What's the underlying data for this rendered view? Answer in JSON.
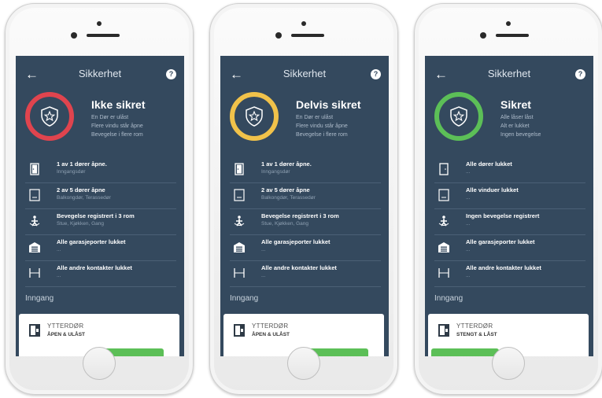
{
  "colors": {
    "red": "#e0444e",
    "yellow": "#f1c24a",
    "green": "#5cbf57",
    "screen_bg": "#34495e"
  },
  "phones": [
    {
      "header": {
        "back": "←",
        "title": "Sikkerhet",
        "help": "?"
      },
      "status": {
        "color": "#e0444e",
        "title": "Ikke sikret",
        "lines": [
          "En Dør er ulåst",
          "Flere vindu står åpne",
          "Bevegelse i flere rom"
        ]
      },
      "rows": [
        {
          "icon": "door-open-icon",
          "title": "1 av 1 dører åpne.",
          "sub": "Inngangsdør"
        },
        {
          "icon": "window-icon",
          "title": "2 av 5 dører åpne",
          "sub": "Balkongdør, Terassedør"
        },
        {
          "icon": "motion-icon",
          "title": "Bevegelse registrert i 3 rom",
          "sub": "Stue, Kjøkken, Gang"
        },
        {
          "icon": "garage-icon",
          "title": "Alle garasjeporter lukket",
          "sub": "..."
        },
        {
          "icon": "contact-icon",
          "title": "Alle andre kontakter lukket",
          "sub": "..."
        }
      ],
      "section": "Inngang",
      "card": {
        "name": "YTTERDØR",
        "state": "ÅPEN & ULÅST"
      }
    },
    {
      "header": {
        "back": "←",
        "title": "Sikkerhet",
        "help": "?"
      },
      "status": {
        "color": "#f1c24a",
        "title": "Delvis sikret",
        "lines": [
          "En Dør er ulåst",
          "Flere vindu står åpne",
          "Bevegelse i flere rom"
        ]
      },
      "rows": [
        {
          "icon": "door-open-icon",
          "title": "1 av 1 dører åpne.",
          "sub": "Inngangsdør"
        },
        {
          "icon": "window-icon",
          "title": "2 av 5 dører åpne",
          "sub": "Balkongdør, Terassedør"
        },
        {
          "icon": "motion-icon",
          "title": "Bevegelse registrert i 3 rom",
          "sub": "Stue, Kjøkken, Gang"
        },
        {
          "icon": "garage-icon",
          "title": "Alle garasjeporter lukket",
          "sub": "..."
        },
        {
          "icon": "contact-icon",
          "title": "Alle andre kontakter lukket",
          "sub": "..."
        }
      ],
      "section": "Inngang",
      "card": {
        "name": "YTTERDØR",
        "state": "ÅPEN & ULÅST"
      }
    },
    {
      "header": {
        "back": "←",
        "title": "Sikkerhet",
        "help": "?"
      },
      "status": {
        "color": "#5cbf57",
        "title": "Sikret",
        "lines": [
          "Alle låser låst",
          "Alt er lukket",
          "Ingen bevegelse"
        ]
      },
      "rows": [
        {
          "icon": "door-closed-icon",
          "title": "Alle dører lukket",
          "sub": "..."
        },
        {
          "icon": "window-icon",
          "title": "Alle vinduer lukket",
          "sub": "..."
        },
        {
          "icon": "motion-icon",
          "title": "Ingen bevegelse registrert",
          "sub": "..."
        },
        {
          "icon": "garage-icon",
          "title": "Alle garasjeporter lukket",
          "sub": "..."
        },
        {
          "icon": "contact-icon",
          "title": "Alle andre kontakter lukket",
          "sub": "..."
        }
      ],
      "section": "Inngang",
      "card": {
        "name": "YTTERDØR",
        "state": "STENGT & LÅST"
      }
    }
  ]
}
